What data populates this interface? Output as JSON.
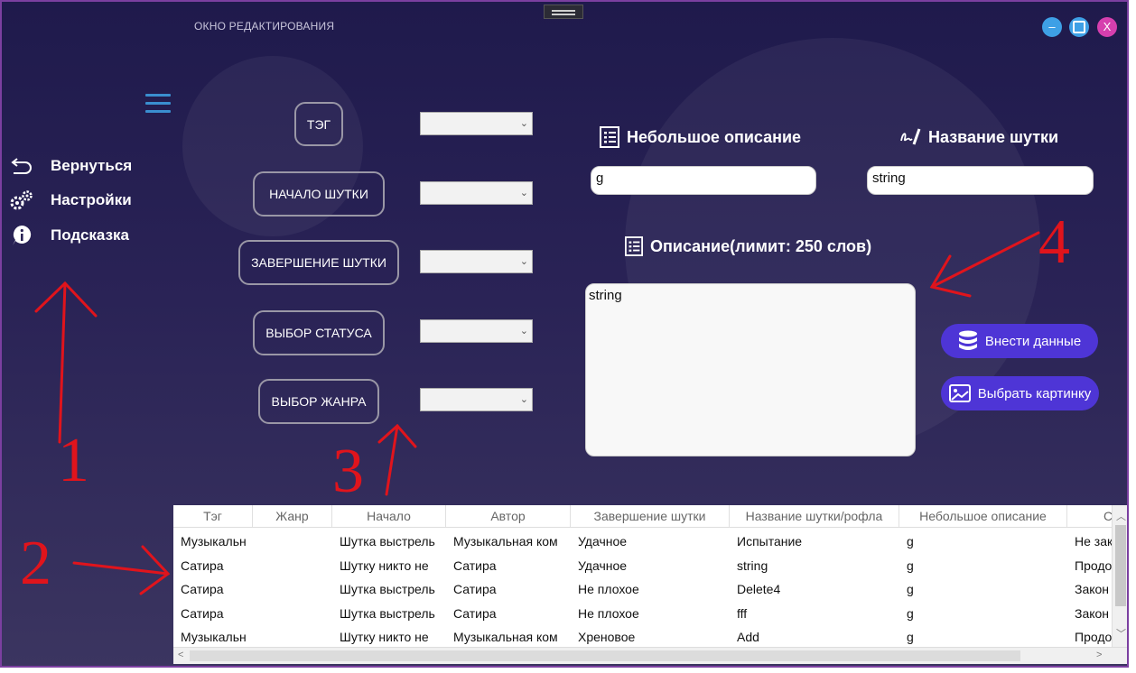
{
  "window": {
    "title": "ОКНО РЕДАКТИРОВАНИЯ",
    "minimize": "–",
    "maximize": "",
    "close": "X"
  },
  "sidebar": {
    "items": [
      {
        "label": "Вернуться",
        "icon": "back-arrow-icon"
      },
      {
        "label": "Настройки",
        "icon": "gears-icon"
      },
      {
        "label": "Подсказка",
        "icon": "info-icon"
      }
    ]
  },
  "fields": [
    {
      "label": "ТЭГ"
    },
    {
      "label": "НАЧАЛО ШУТКИ"
    },
    {
      "label": "ЗАВЕРШЕНИЕ ШУТКИ"
    },
    {
      "label": "ВЫБОР СТАТУСА"
    },
    {
      "label": "ВЫБОР ЖАНРА"
    }
  ],
  "form": {
    "short_desc_label": "Небольшое описание",
    "short_desc_value": "g",
    "joke_name_label": "Название шутки",
    "joke_name_value": "string",
    "desc_label": "Описание(лимит: 250 слов)",
    "desc_value": "string",
    "submit_label": "Внести данные",
    "pick_image_label": "Выбрать картинку"
  },
  "table": {
    "columns": [
      "Тэг",
      "Жанр",
      "Начало",
      "Автор",
      "Завершение шутки",
      "Название шутки/рофла",
      "Небольшое описание",
      "С"
    ],
    "rows": [
      [
        "Музыкальн",
        "",
        "Шутка выстрель",
        "Музыкальная ком",
        "Удачное",
        "Испытание",
        "g",
        "Не зак"
      ],
      [
        "Сатира",
        "",
        "Шутку никто не",
        "Сатира",
        "Удачное",
        "string",
        "g",
        "Продо"
      ],
      [
        "Сатира",
        "",
        "Шутка выстрель",
        "Сатира",
        "Не плохое",
        "Delete4",
        "g",
        "Закон"
      ],
      [
        "Сатира",
        "",
        "Шутка выстрель",
        "Сатира",
        "Не плохое",
        "fff",
        "g",
        "Закон"
      ],
      [
        "Музыкальн",
        "",
        "Шутку никто не",
        "Музыкальная ком",
        "Хреновое",
        "Add",
        "g",
        "Продо"
      ]
    ]
  },
  "annotations": [
    "1",
    "2",
    "3",
    "4"
  ],
  "colors": {
    "accent": "#4e35d6",
    "annotation": "#e0141c",
    "minimize": "#3ea0e6",
    "maximize": "#3ea0e6",
    "close": "#d63fae"
  }
}
